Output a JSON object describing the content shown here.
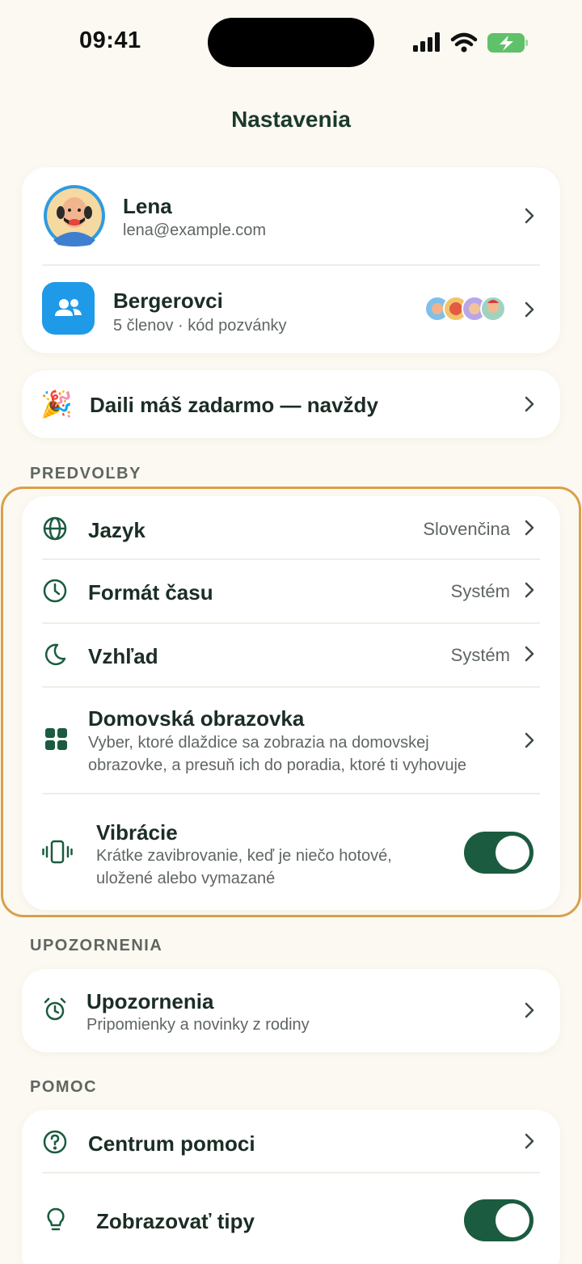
{
  "status_bar": {
    "time": "09:41"
  },
  "header": {
    "title": "Nastavenia"
  },
  "profile": {
    "name": "Lena",
    "email": "lena@example.com"
  },
  "family": {
    "name": "Bergerovci",
    "subtitle": "5 členov · kód pozvánky"
  },
  "promo": {
    "emoji": "🎉",
    "label": "Daili máš zadarmo — navždy"
  },
  "preferences": {
    "section_label": "PREDVOĽBY",
    "language": {
      "label": "Jazyk",
      "value": "Slovenčina"
    },
    "time_format": {
      "label": "Formát času",
      "value": "Systém"
    },
    "appearance": {
      "label": "Vzhľad",
      "value": "Systém"
    },
    "home_screen": {
      "label": "Domovská obrazovka",
      "description_line1": "Vyber, ktoré dlaždice sa zobrazia na domovskej",
      "description_line2": "obrazovke, a presuň ich do poradia, ktoré ti vyhovuje"
    },
    "haptics": {
      "label": "Vibrácie",
      "description_line1": "Krátke zavibrovanie, keď je niečo hotové,",
      "description_line2": "uložené alebo vymazané",
      "enabled": true
    }
  },
  "notifications": {
    "section_label": "UPOZORNENIA",
    "item": {
      "label": "Upozornenia",
      "description": "Pripomienky a novinky z rodiny"
    }
  },
  "help": {
    "section_label": "POMOC",
    "help_center": {
      "label": "Centrum pomoci"
    },
    "show_tips": {
      "label": "Zobrazovať tipy",
      "enabled": true
    }
  },
  "colors": {
    "background": "#fbf9f1",
    "accent_green": "#1b5b3f",
    "family_blue": "#1e9ae8",
    "highlight_orange": "#d9a04a"
  }
}
